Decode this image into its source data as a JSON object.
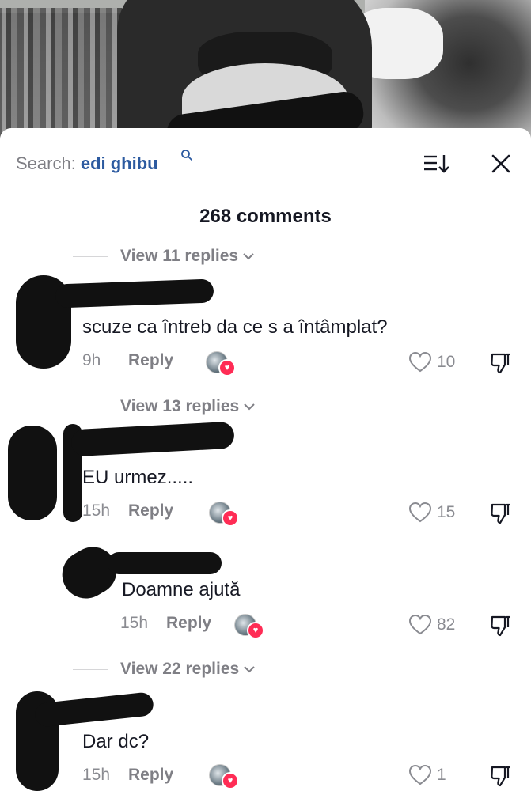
{
  "search": {
    "prefix": "Search:",
    "query": "edi ghibu"
  },
  "comments_title": "268 comments",
  "threads": [
    {
      "view_replies": "View 11 replies",
      "text": "scuze ca întreb da ce s a întâmplat?",
      "time": "9h",
      "reply_label": "Reply",
      "likes": "10"
    },
    {
      "view_replies": "View 13 replies",
      "text": "EU urmez.....",
      "time": "15h",
      "reply_label": "Reply",
      "likes": "15"
    },
    {
      "view_replies": "",
      "text": "Doamne ajută",
      "time": "15h",
      "reply_label": "Reply",
      "likes": "82"
    },
    {
      "view_replies": "View 22 replies",
      "text": "Dar dc?",
      "time": "15h",
      "reply_label": "Reply",
      "likes": "1"
    }
  ],
  "icons": [
    "search-icon",
    "sort-icon",
    "close-icon",
    "chevron-down-icon",
    "heart-icon",
    "dislike-icon",
    "creator-avatar"
  ],
  "colors": {
    "query_blue": "#2c5aa0",
    "liked_red": "#ff2c55",
    "muted_gray": "#8a8b91"
  }
}
